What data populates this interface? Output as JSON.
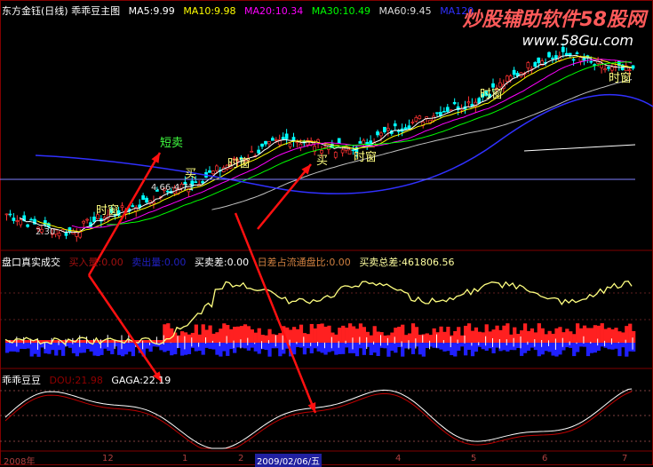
{
  "header": {
    "title": "东方金钰(日线) 乖乖豆主图",
    "ma5": "MA5:9.99",
    "ma10": "MA10:9.98",
    "ma20": "MA20:10.34",
    "ma30": "MA30:10.49",
    "ma60": "MA60:9.45",
    "ma120": "MA120"
  },
  "watermark": {
    "line1": "炒股辅助软件58股网",
    "line2": "www.58Gu.com"
  },
  "panel2": {
    "title": "盘口真实成交",
    "buy": "买入量:0.00",
    "sell": "卖出量:0.00",
    "diff": "买卖差:0.00",
    "ratio": "日差占流通盘比:0.00",
    "total": "买卖总差:461806.56"
  },
  "panel3": {
    "title": "乖乖豆豆",
    "dou": "DOU:21.98",
    "gaga": "GAGA:22.19"
  },
  "annotations": {
    "short_sell": "短卖",
    "buy": "买",
    "window": "时窗",
    "range": "4.66-4.71",
    "low": "2.30"
  },
  "colors": {
    "up": "#ff3232",
    "down": "#00ffff",
    "ma5": "#ffffff",
    "ma10": "#ffff00",
    "ma20": "#ff00ff",
    "ma30": "#00ff00",
    "ma60": "#c0c0c0",
    "ma120": "#3030ff",
    "border": "#800000"
  },
  "chart_data": {
    "type": "candlestick",
    "title": "东方金钰(日线)",
    "price_trend": [
      3.2,
      2.6,
      2.3,
      3.0,
      3.5,
      4.2,
      4.7,
      5.5,
      6.2,
      6.8,
      6.5,
      6.2,
      7.0,
      7.6,
      8.2,
      8.6,
      9.6,
      10.6,
      10.8,
      10.2,
      10.0
    ],
    "x_ticks": [
      "2008年",
      "12",
      "1",
      "2",
      "2009/02/06/五",
      "4",
      "5",
      "6",
      "7"
    ],
    "panels": [
      "price",
      "盘口真实成交",
      "乖乖豆豆"
    ]
  }
}
